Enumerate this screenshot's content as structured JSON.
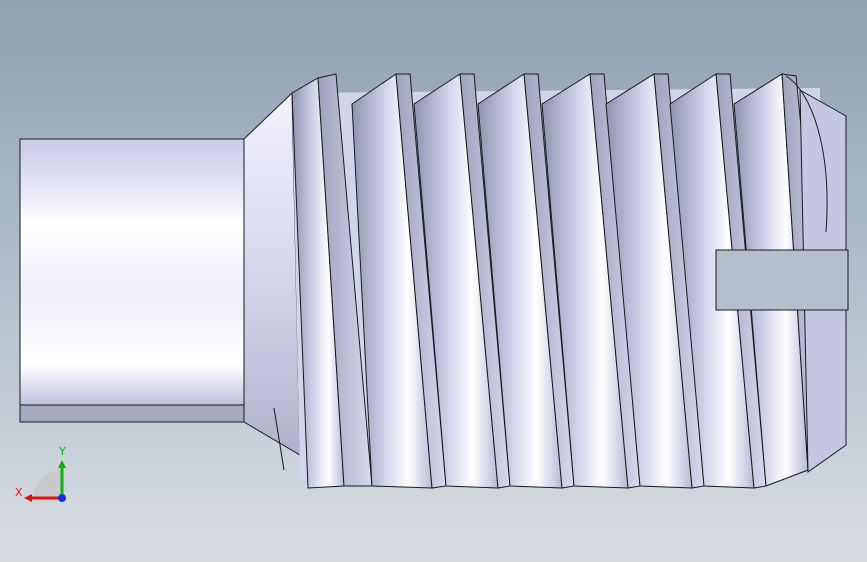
{
  "model": {
    "part": "slotted-set-screw",
    "colors": {
      "background_top": "#8fa0b2",
      "background_bottom": "#d8dde2",
      "metal_light": "#ffffff",
      "metal_mid": "#c9cbe6",
      "metal_dark": "#8f93ad",
      "edge": "#1a1a1a",
      "slot_fill": "#b4bfcb"
    }
  },
  "triad": {
    "x_label": "X",
    "y_label": "Y",
    "x_color": "#e01010",
    "y_color": "#10b010",
    "z_color": "#1030e0"
  }
}
